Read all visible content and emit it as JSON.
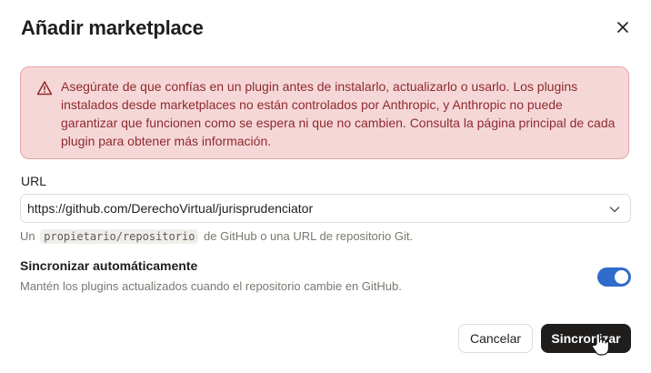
{
  "dialog": {
    "title": "Añadir marketplace"
  },
  "warning": {
    "text": "Asegúrate de que confías en un plugin antes de instalarlo, actualizarlo o usarlo. Los plugins instalados desde marketplaces no están controlados por Anthropic, y Anthropic no puede garantizar que funcionen como se espera ni que no cambien. Consulta la página principal de cada plugin para obtener más información.",
    "icon": "alert-triangle-icon",
    "color": "#8e2a2e",
    "background": "#f6d7d8"
  },
  "url": {
    "label": "URL",
    "value": "https://github.com/DerechoVirtual/jurisprudenciator",
    "hint_prefix": "Un",
    "hint_code": "propietario/repositorio",
    "hint_suffix": "de GitHub o una URL de repositorio Git."
  },
  "auto_sync": {
    "title": "Sincronizar automáticamente",
    "description": "Mantén los plugins actualizados cuando el repositorio cambie en GitHub.",
    "enabled": true,
    "accent": "#2f6cca"
  },
  "actions": {
    "cancel_label": "Cancelar",
    "sync_label": "Sincronizar"
  }
}
